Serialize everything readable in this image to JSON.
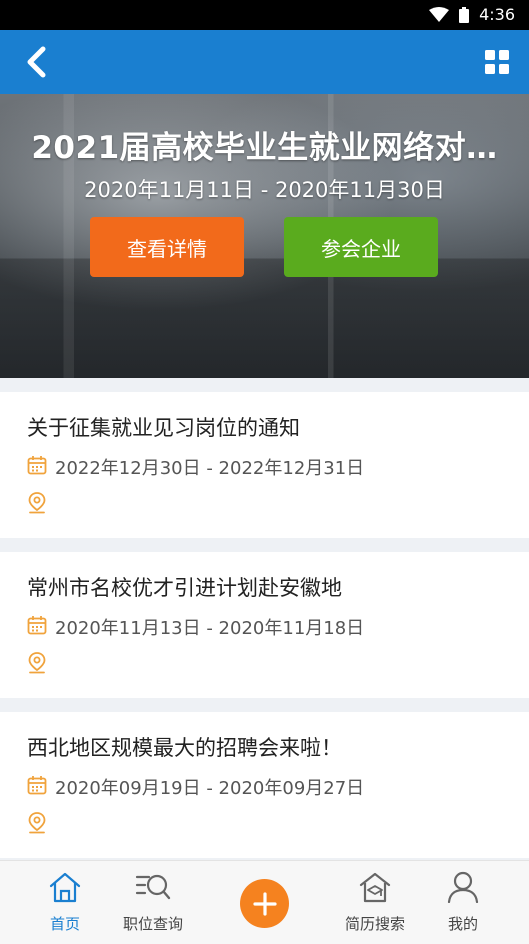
{
  "status_bar": {
    "time": "4:36"
  },
  "banner": {
    "title": "2021届高校毕业生就业网络对…",
    "date_range": "2020年11月11日 - 2020年11月30日",
    "detail_button": "查看详情",
    "company_button": "参会企业"
  },
  "cards": [
    {
      "title": "关于征集就业见习岗位的通知",
      "date_range": "2022年12月30日 - 2022年12月31日"
    },
    {
      "title": "常州市名校优才引进计划赴安徽地",
      "date_range": "2020年11月13日 - 2020年11月18日"
    },
    {
      "title": "西北地区规模最大的招聘会来啦！",
      "date_range": "2020年09月19日 - 2020年09月27日"
    }
  ],
  "tabbar": {
    "home": "首页",
    "jobs": "职位查询",
    "resume": "简历搜索",
    "mine": "我的"
  },
  "colors": {
    "primary": "#1a7fd0",
    "orange": "#f26a1b",
    "green": "#5aab1e",
    "fab": "#f5821f"
  }
}
